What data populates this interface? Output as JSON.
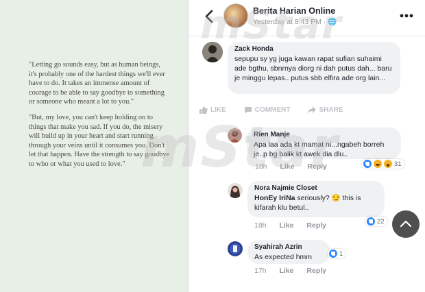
{
  "quote": {
    "paragraph1": "\"Letting go sounds easy, but as human beings, it's probably one of the hardest things we'll ever have to do. It takes an immense amount of courage to be able to say goodbye to something or someone who meant a lot to you.\"",
    "paragraph2": "\"But, my love, you can't keep holding on to things that make you sad. If you do, the misery will build up in your heart and start running through your veins until it consumes you. Don't let that happen. Have the strength to say goodbye to who or what you used to love.\""
  },
  "header": {
    "page_name": "Berita Harian Online",
    "post_meta": "Yesterday at 8:43 PM · 🌐"
  },
  "post_actions": {
    "like": "LIKE",
    "comment": "COMMENT",
    "share": "SHARE"
  },
  "comments": [
    {
      "name": "Zack Honda",
      "text": "sepupu sy yg juga kawan rapat sufian suhaimi ade bgthu, sbnrnya diorg ni dah putus dah... baru je minggu lepas.. putus sbb elfira ade org lain..."
    },
    {
      "name": "Rien Manje",
      "text": "Apa laa ada kt mamat ni...ngabeh borreh je..p bg balik kt awek dia dlu..",
      "time": "18h",
      "like": "Like",
      "reply": "Reply",
      "reaction_count": "31"
    },
    {
      "name": "Nora Najmie Closet",
      "mention": "HonEy IriNa",
      "text": " seriously? 😏 this is kifarah klu betul..",
      "time": "18h",
      "like": "Like",
      "reply": "Reply",
      "reaction_count": "22"
    },
    {
      "name": "Syahirah Azrin",
      "text": "As expected hmm",
      "time": "17h",
      "like": "Like",
      "reply": "Reply",
      "reaction_count": "1"
    }
  ],
  "watermark": "mStar",
  "colors": {
    "facebook_blue": "#2d88ff",
    "bubble_gray": "#f0f1f3",
    "quote_background": "#e8efe6",
    "scroll_button": "#4f4f4f"
  }
}
